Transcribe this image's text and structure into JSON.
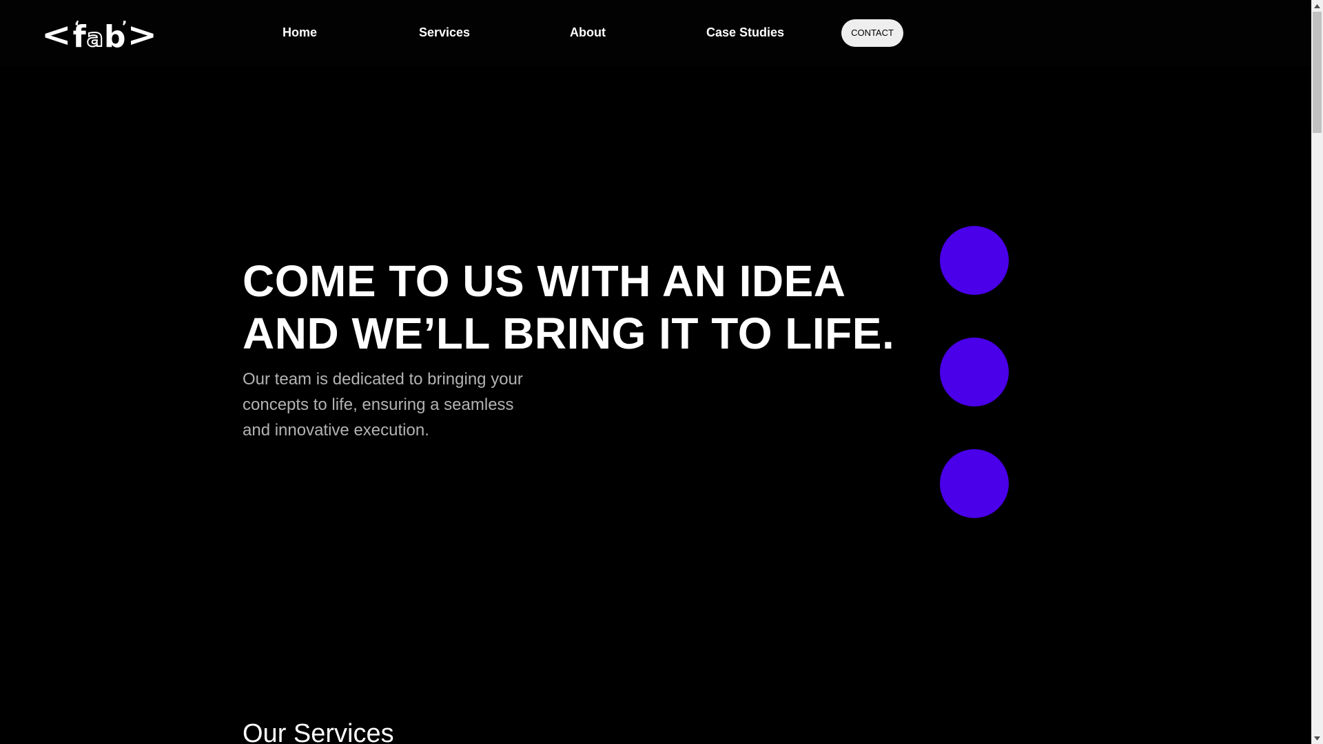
{
  "header": {
    "logo": {
      "left_bracket": "<",
      "tick1": "ʻ",
      "letter_f": "f",
      "letter_a": "a",
      "letter_b": "b",
      "tick2": "ʼ",
      "right_bracket": ">"
    },
    "nav": {
      "home": "Home",
      "services": "Services",
      "about": "About",
      "case_studies": "Case Studies",
      "contact": "CONTACT"
    }
  },
  "hero": {
    "title_line1": "COME TO US WITH AN IDEA",
    "title_line2": "AND WE’LL BRING IT TO LIFE.",
    "subtitle_line1": "Our team is dedicated to bringing your",
    "subtitle_line2": "concepts to life, ensuring a seamless",
    "subtitle_line3": "and innovative execution.",
    "dot_color": "#4a00e8"
  },
  "services": {
    "heading": "Our Services"
  },
  "colors": {
    "background": "#000000",
    "accent": "#4a00e8",
    "contact_bg": "#eeeeee"
  }
}
